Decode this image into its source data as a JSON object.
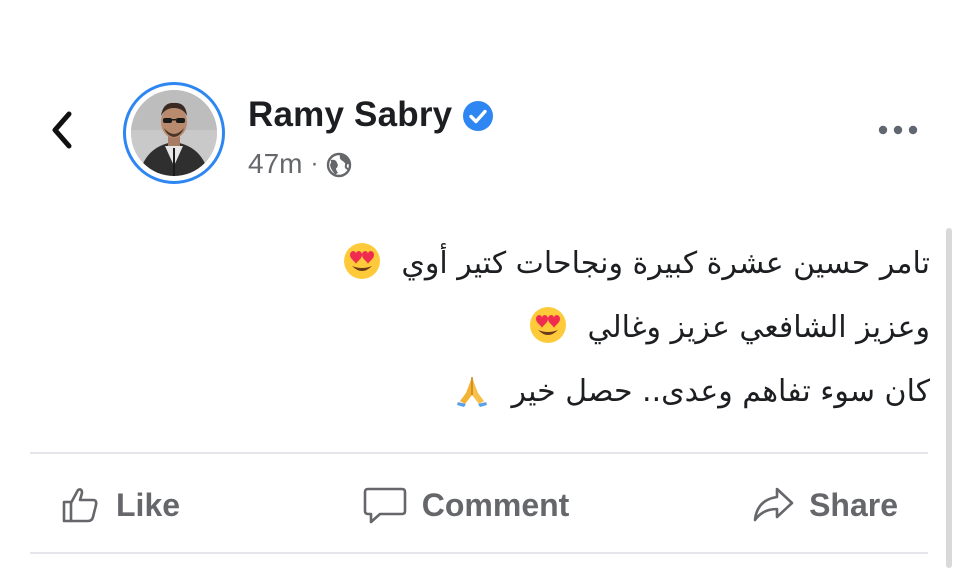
{
  "post": {
    "author": "Ramy Sabry",
    "time": "47m",
    "separator": "·",
    "lines": [
      "تامر حسين عشرة كبيرة ونجاحات كتير أوي",
      "وعزيز الشافعي عزيز وغالي",
      "كان سوء تفاهم وعدى.. حصل خير"
    ],
    "line_emojis": [
      "heart-eyes-emoji",
      "heart-eyes-emoji",
      "folded-hands-emoji"
    ]
  },
  "actions": {
    "like": "Like",
    "comment": "Comment",
    "share": "Share"
  },
  "icons": {
    "back": "chevron-left-icon",
    "verified": "verified-badge-icon",
    "privacy": "globe-icon",
    "more": "more-horizontal-icon",
    "like": "thumbs-up-icon",
    "comment": "speech-bubble-icon",
    "share": "share-arrow-icon"
  },
  "colors": {
    "accent": "#2e86f2",
    "text": "#1c1e21",
    "secondary": "#65676b",
    "divider": "#e4e6eb"
  }
}
